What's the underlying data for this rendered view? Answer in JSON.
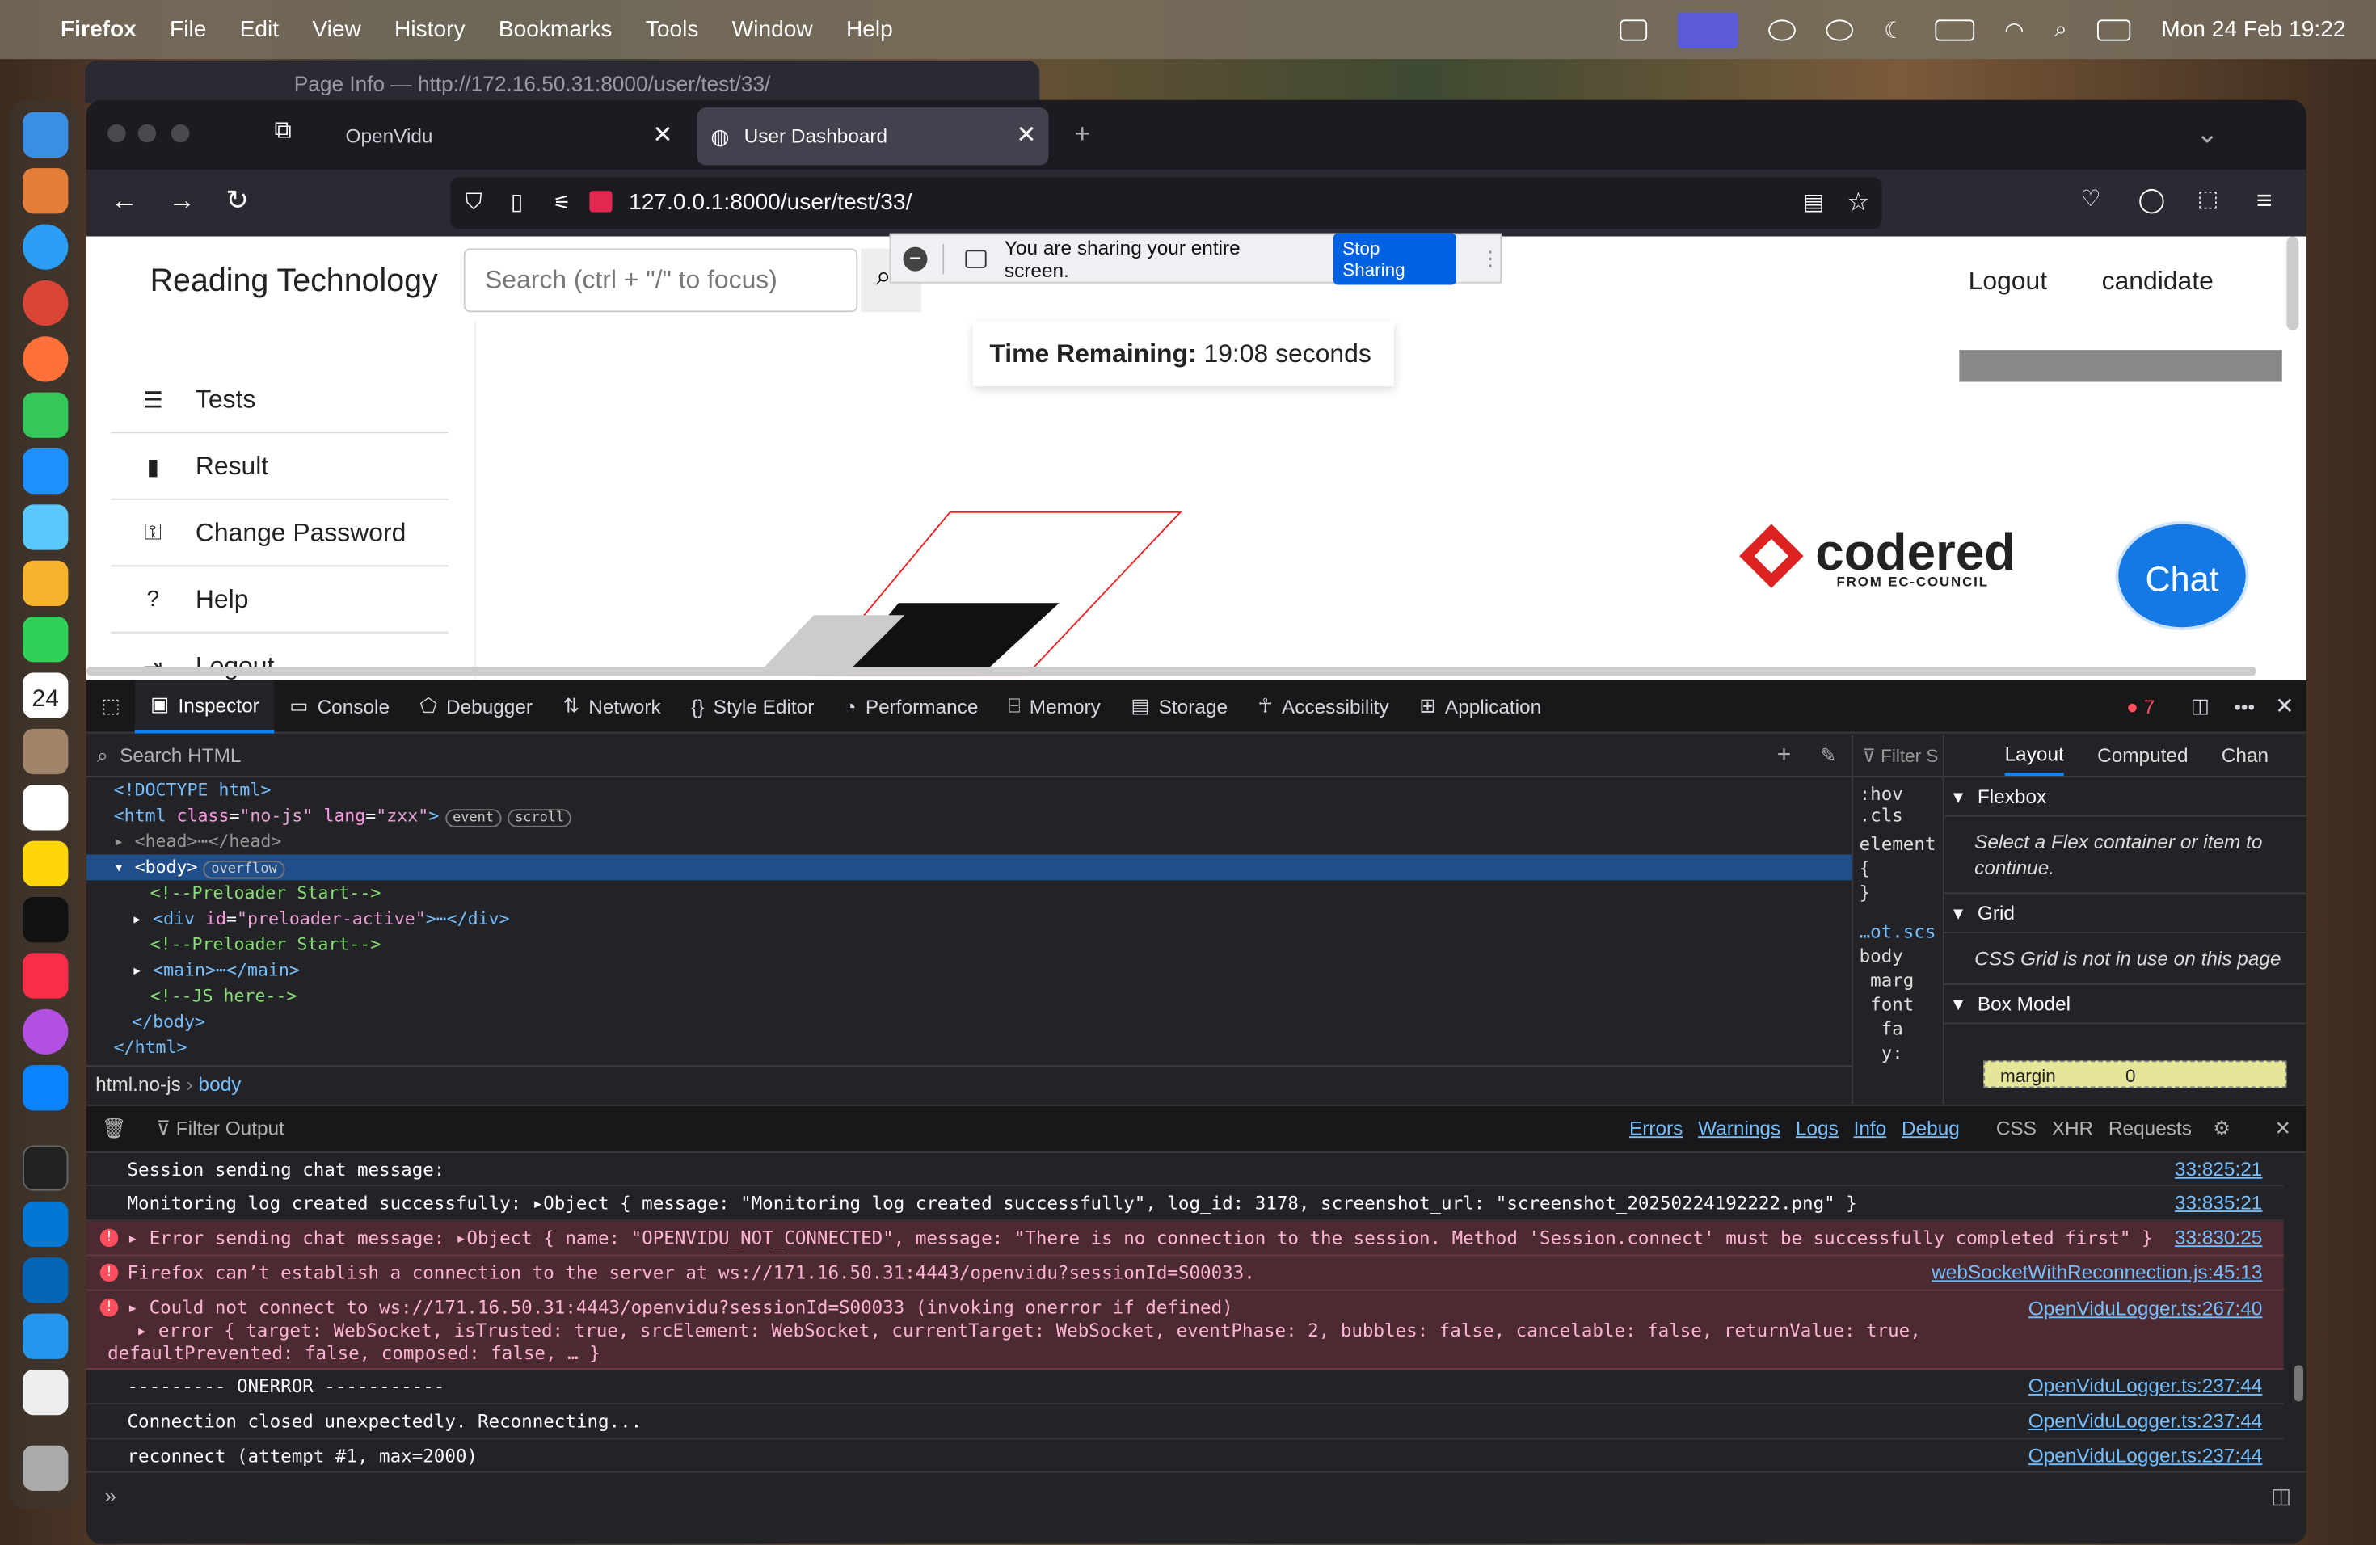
{
  "menubar": {
    "app": "Firefox",
    "items": [
      "File",
      "Edit",
      "View",
      "History",
      "Bookmarks",
      "Tools",
      "Window",
      "Help"
    ],
    "datetime": "Mon 24 Feb  19:22"
  },
  "bg_window": {
    "title": "Page Info — http://172.16.50.31:8000/user/test/33/"
  },
  "tabs": [
    {
      "label": "OpenVidu"
    },
    {
      "label": "User Dashboard"
    }
  ],
  "url": "127.0.0.1:8000/user/test/33/",
  "share": {
    "text": "You are sharing your entire screen.",
    "stop": "Stop Sharing"
  },
  "page": {
    "brand": "Reading Technology",
    "search_placeholder": "Search (ctrl + \"/\" to focus)",
    "logout": "Logout",
    "user": "candidate",
    "timer_label": "Time Remaining:",
    "timer_value": "19:08 seconds",
    "sidebar": [
      {
        "label": "Tests",
        "icon": "list-icon"
      },
      {
        "label": "Result",
        "icon": "clipboard-icon"
      },
      {
        "label": "Change Password",
        "icon": "key-icon"
      },
      {
        "label": "Help",
        "icon": "question-icon"
      },
      {
        "label": "Logout",
        "icon": "logout-icon"
      }
    ],
    "logo": "codered",
    "logo_sub": "FROM EC-COUNCIL",
    "chat": "Chat"
  },
  "devtools": {
    "tabs": [
      "Inspector",
      "Console",
      "Debugger",
      "Network",
      "Style Editor",
      "Performance",
      "Memory",
      "Storage",
      "Accessibility",
      "Application"
    ],
    "error_count": "7",
    "search_html": "Search HTML",
    "filter_styles": "Filter S",
    "side_tabs": [
      "Layout",
      "Computed",
      "Chan"
    ],
    "flexbox": "Flexbox",
    "flex_note": "Select a Flex container or item to continue.",
    "grid": "Grid",
    "grid_note": "CSS Grid is not in use on this page",
    "box": "Box Model",
    "margin": "margin",
    "margin_val": "0",
    "crumbs": [
      "html.no-js",
      "body"
    ],
    "filter_output": "Filter Output",
    "levels": [
      "Errors",
      "Warnings",
      "Logs",
      "Info",
      "Debug"
    ],
    "extra": [
      "CSS",
      "XHR",
      "Requests"
    ],
    "log": [
      {
        "text": "Session sending chat message:",
        "src": "33:825:21",
        "err": false
      },
      {
        "text": "Monitoring log created successfully: ▸Object { message: \"Monitoring log created successfully\", log_id: 3178, screenshot_url: \"screenshot_20250224192222.png\" }",
        "src": "33:835:21",
        "err": false
      },
      {
        "text": "▸ Error sending chat message: ▸Object { name: \"OPENVIDU_NOT_CONNECTED\", message: \"There is no connection to the session. Method 'Session.connect' must be successfully completed first\" }",
        "src": "33:830:25",
        "err": true
      },
      {
        "text": "Firefox can’t establish a connection to the server at ws://171.16.50.31:4443/openvidu?sessionId=S00033.",
        "src": "webSocketWithReconnection.js:45:13",
        "err": true
      },
      {
        "text": "▸ Could not connect to ws://171.16.50.31:4443/openvidu?sessionId=S00033 (invoking onerror if defined)",
        "src": "OpenViduLogger.ts:267:40",
        "err": true
      },
      {
        "text": "--------- ONERROR -----------",
        "src": "OpenViduLogger.ts:237:44",
        "err": false
      },
      {
        "text": "Connection closed unexpectedly. Reconnecting...",
        "src": "OpenViduLogger.ts:237:44",
        "err": false
      },
      {
        "text": "reconnect (attempt #1, max=2000)",
        "src": "OpenViduLogger.ts:237:44",
        "err": false
      }
    ],
    "err_detail1": "▸ error { target: WebSocket, isTrusted: true, srcElement: WebSocket, currentTarget: WebSocket, eventPhase: 2, bubbles: false, cancelable: false, returnValue: true,",
    "err_detail2": "defaultPrevented: false, composed: false, … }"
  }
}
